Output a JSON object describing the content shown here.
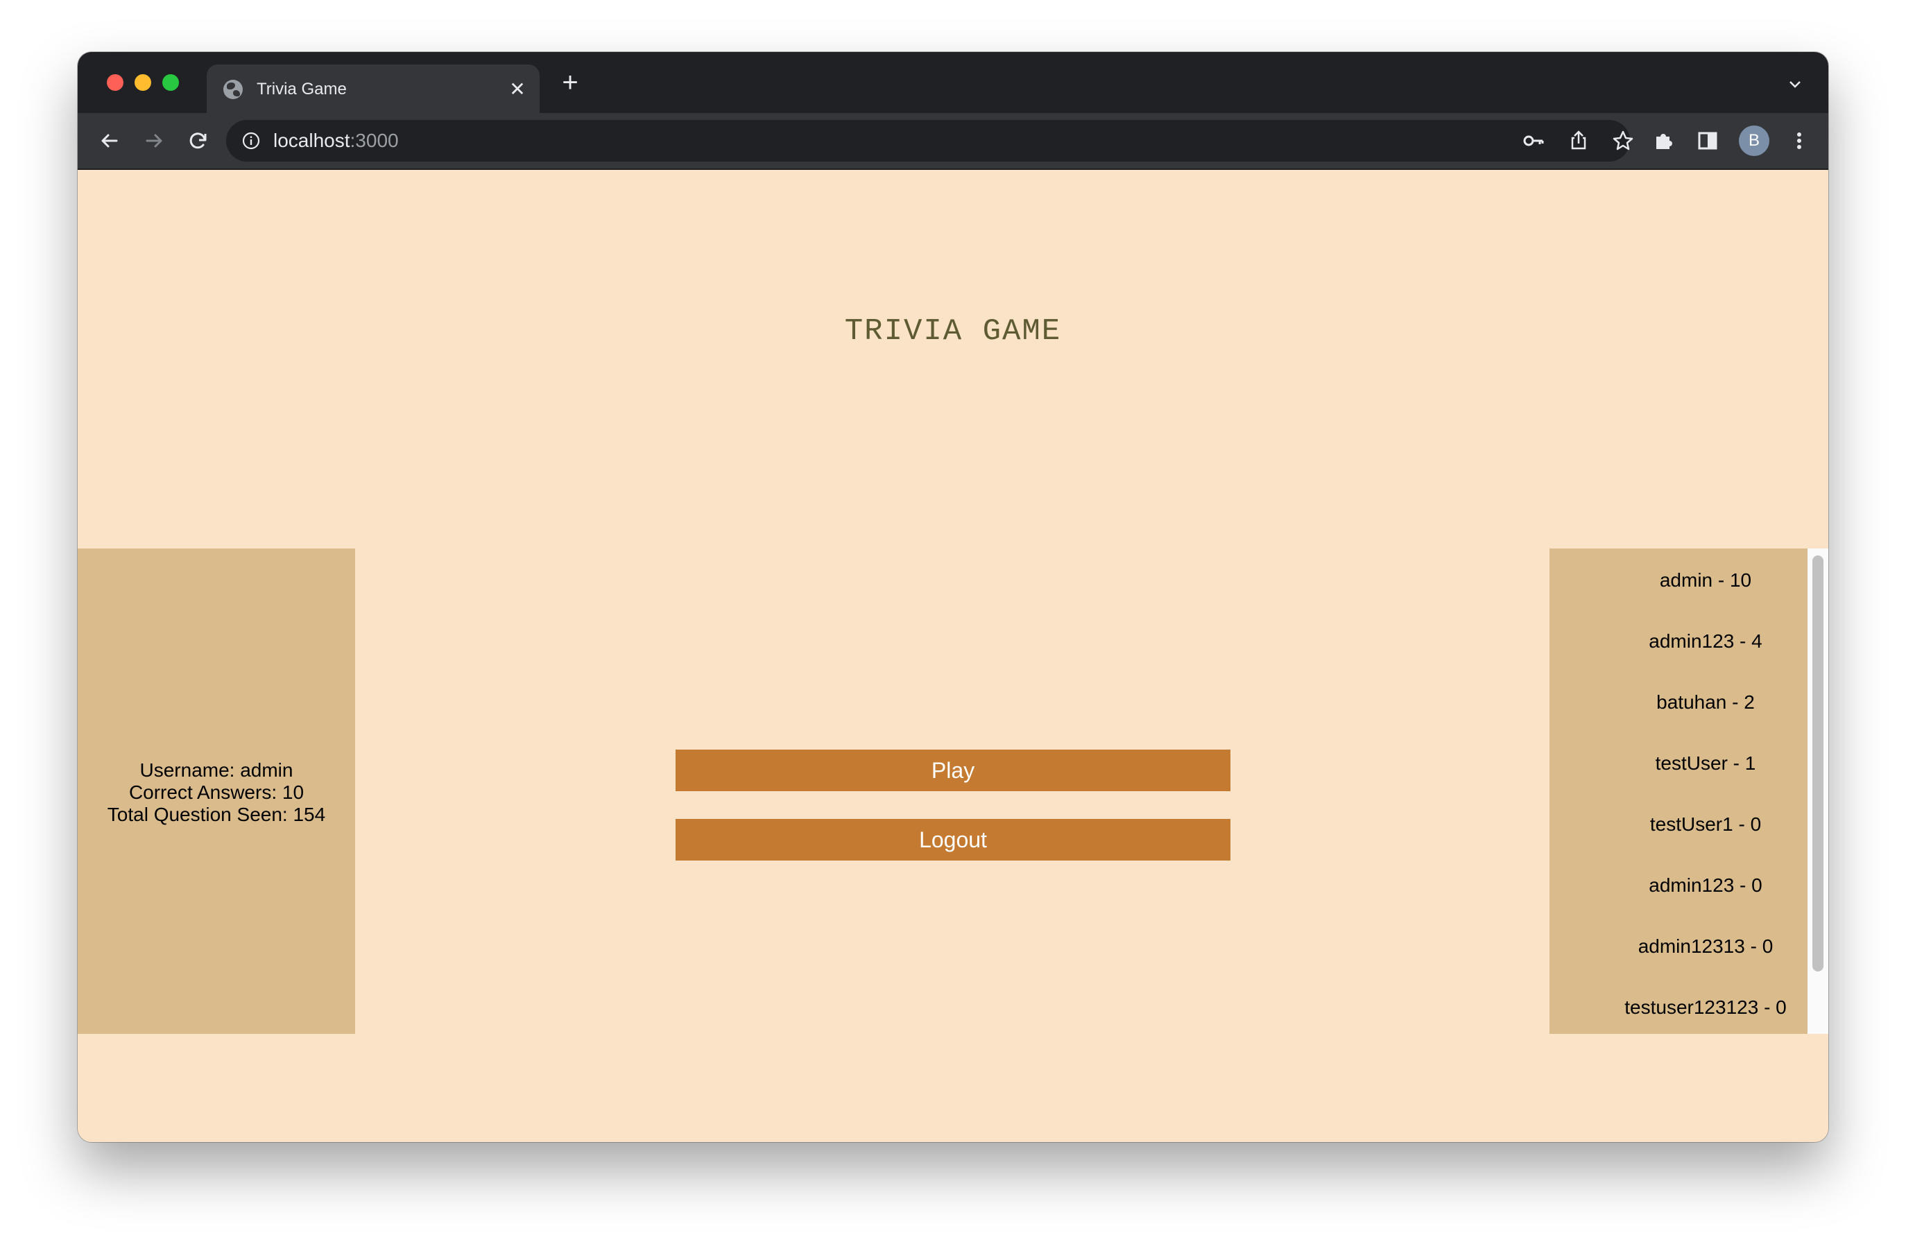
{
  "browser": {
    "tab_title": "Trivia Game",
    "tab_close": "✕",
    "new_tab": "+",
    "url_host": "localhost",
    "url_port": ":3000",
    "profile_initial": "B"
  },
  "page": {
    "title": "TRIVIA GAME",
    "user_stats": {
      "username": "Username: admin",
      "correct": "Correct Answers: 10",
      "total": "Total Question Seen: 154"
    },
    "buttons": {
      "play": "Play",
      "logout": "Logout"
    },
    "leaderboard": [
      "admin - 10",
      "admin123 - 4",
      "batuhan - 2",
      "testUser - 1",
      "testUser1 - 0",
      "admin123 - 0",
      "admin12313 - 0",
      "testuser123123 - 0"
    ]
  },
  "colors": {
    "page_background": "#fae3c6",
    "panel_background": "#d9bb8c",
    "button_background": "#c57a31",
    "title_color": "#5e5a32"
  },
  "icons": {
    "tab_favicon": "globe-icon",
    "back": "arrow-left-icon",
    "forward": "arrow-right-icon",
    "reload": "reload-icon",
    "site_info": "info-icon",
    "password": "key-icon",
    "share": "share-icon",
    "bookmark": "star-icon",
    "extensions": "puzzle-icon",
    "side_panel": "side-panel-icon",
    "menu": "kebab-menu-icon",
    "tab_list": "chevron-down-icon"
  }
}
